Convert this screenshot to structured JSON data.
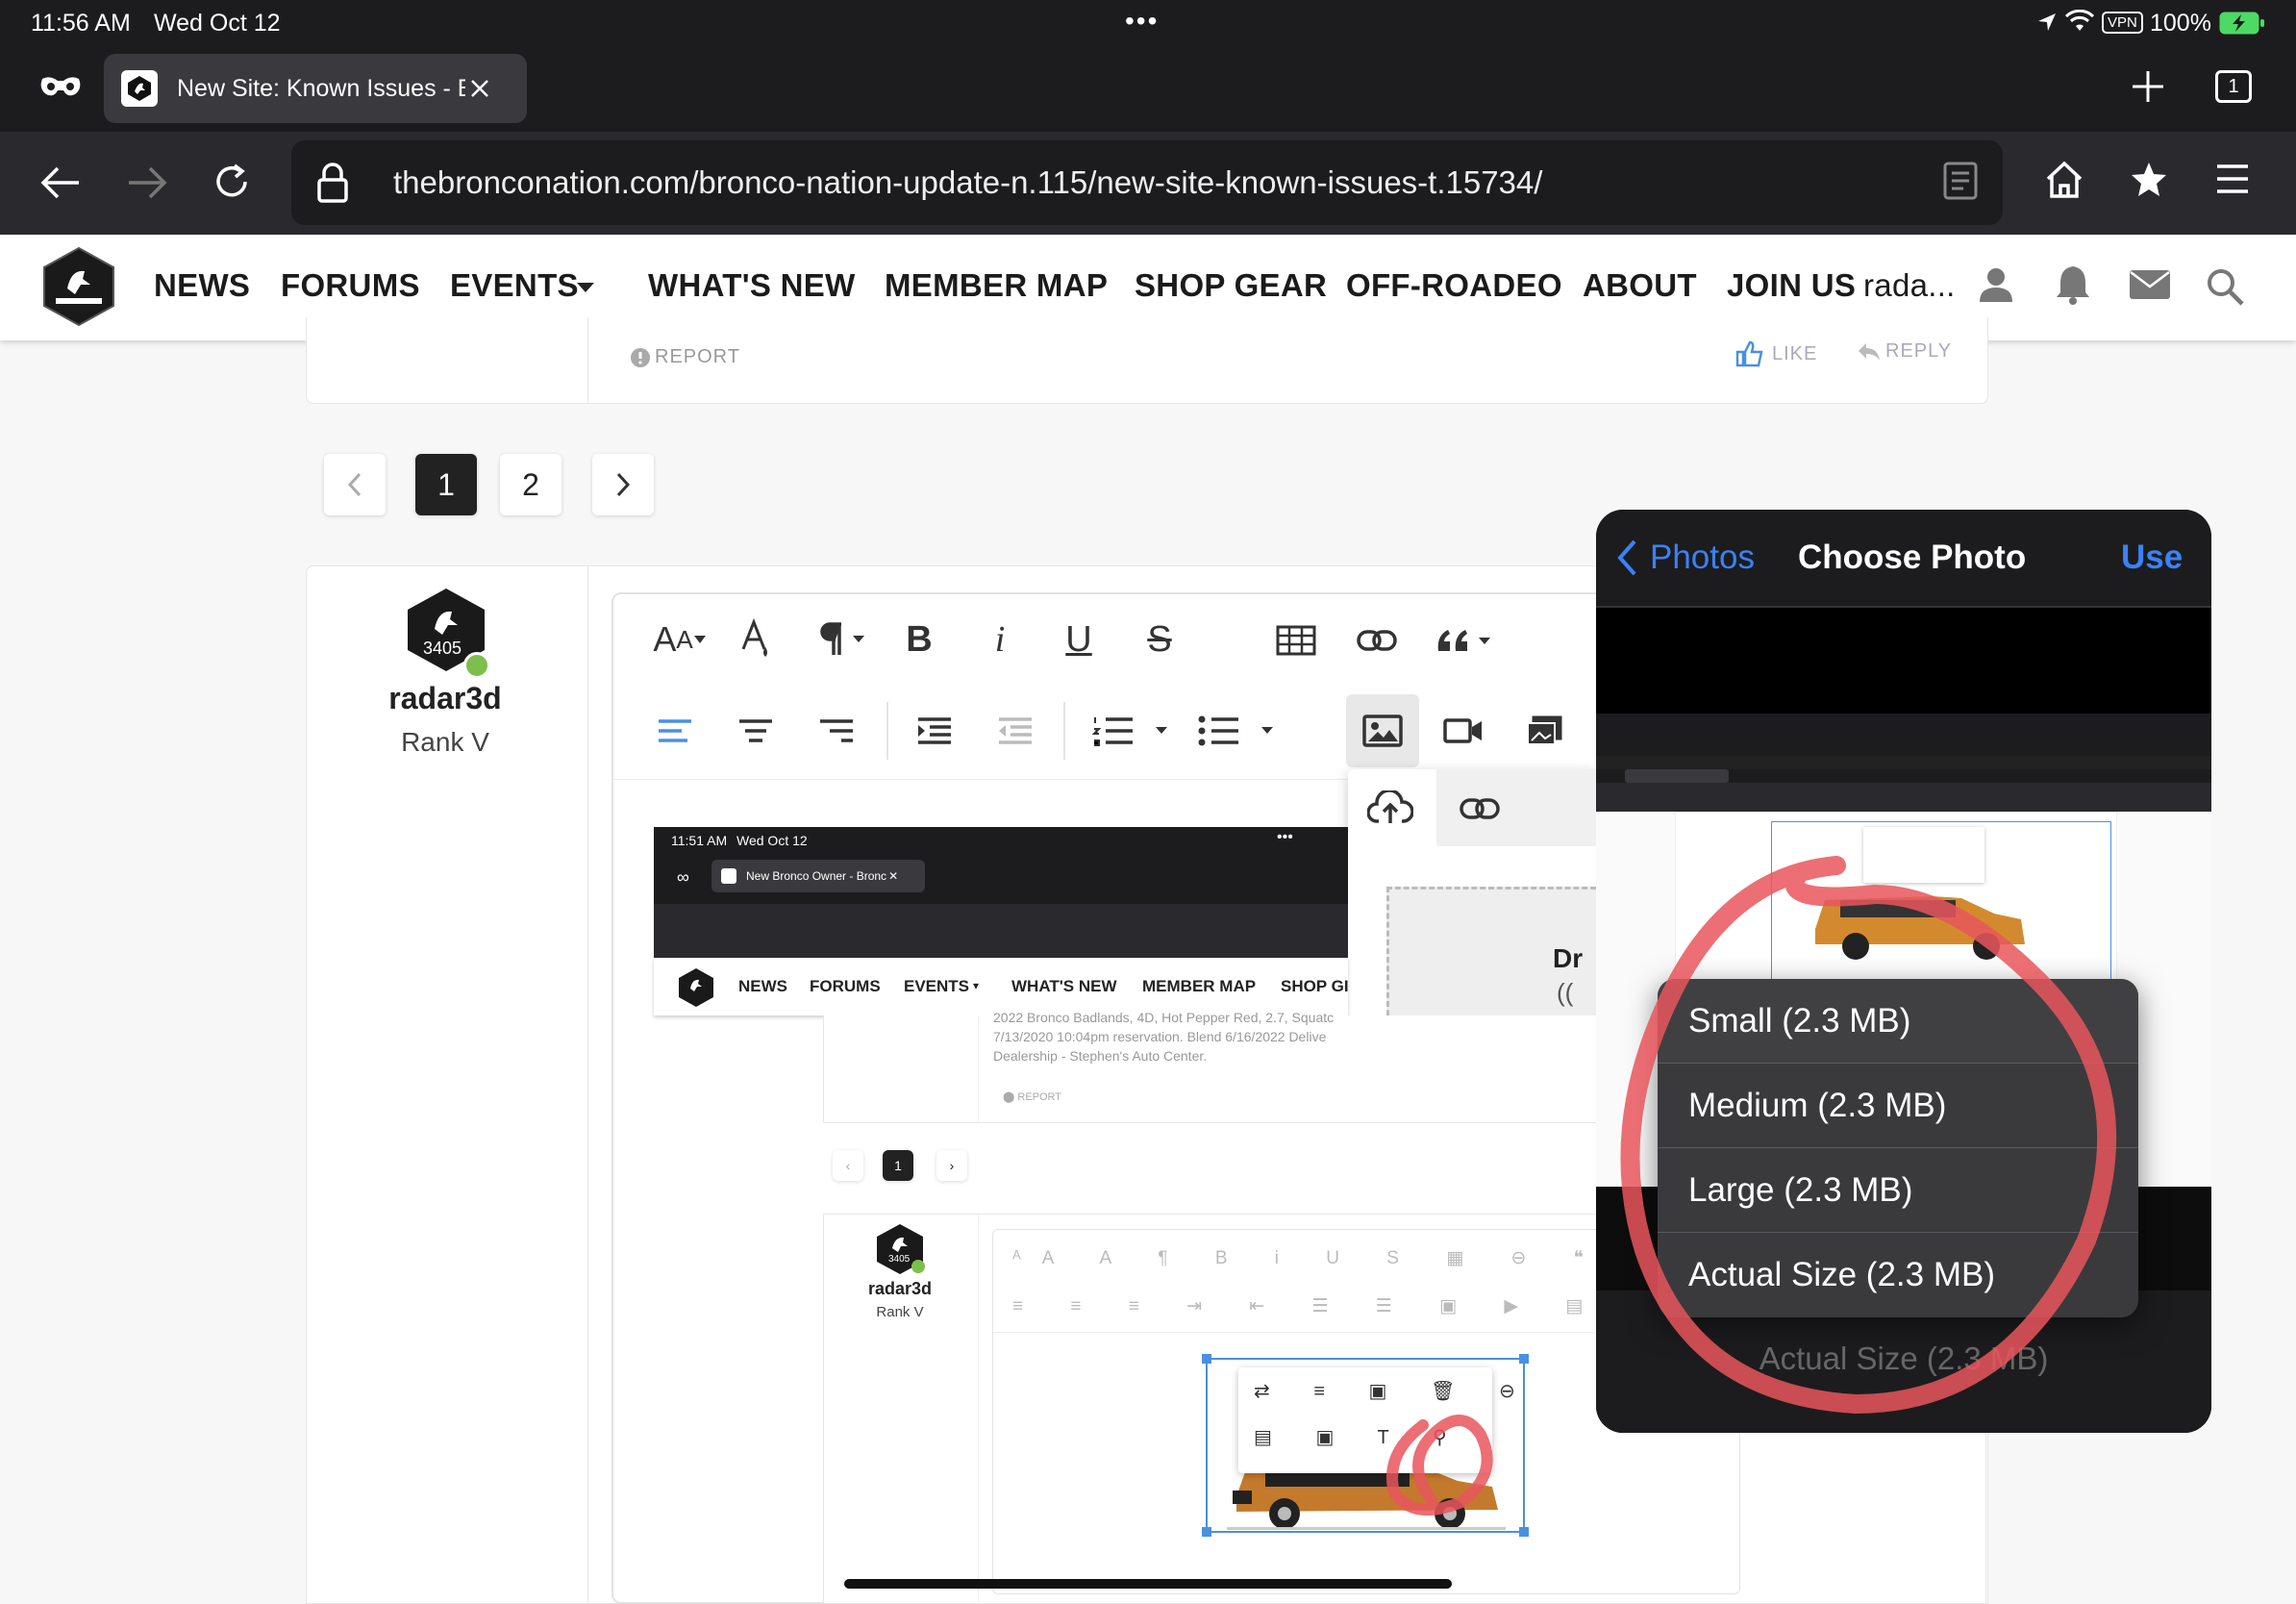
{
  "status": {
    "time": "11:56 AM",
    "date": "Wed Oct 12",
    "dots": "•••",
    "vpn": "VPN",
    "battery": "100%"
  },
  "browser": {
    "tab_title": "New Site: Known Issues - Bı",
    "tab_count": "1",
    "url": "thebronconation.com/bronco-nation-update-n.115/new-site-known-issues-t.15734/"
  },
  "site_nav": {
    "items": [
      "NEWS",
      "FORUMS",
      "EVENTS",
      "WHAT'S NEW",
      "MEMBER MAP",
      "SHOP GEAR",
      "OFF-ROADEO",
      "ABOUT",
      "JOIN US"
    ],
    "user": "rada..."
  },
  "post_actions": {
    "report": "REPORT",
    "like": "LIKE",
    "reply": "REPLY"
  },
  "pagination": {
    "pages": [
      "1",
      "2"
    ],
    "current": "1"
  },
  "author": {
    "name": "radar3d",
    "rank": "Rank V",
    "badge": "3405"
  },
  "editor": {
    "insert_popup_drop": "Dr",
    "insert_popup_sub": "(("
  },
  "embedded": {
    "status_time": "11:51 AM",
    "status_date": "Wed Oct 12",
    "tab_title": "New Bronco Owner - Bronc",
    "nav": [
      "NEWS",
      "FORUMS",
      "EVENTS",
      "WHAT'S NEW",
      "MEMBER MAP",
      "SHOP GI"
    ],
    "post_line1": "2022 Bronco Badlands, 4D, Hot Pepper Red, 2.7, Squatc",
    "post_line2": "7/13/2020 10:04pm reservation. Blend 6/16/2022 Delive",
    "post_line3": "Dealership - Stephen's Auto Center.",
    "report": "REPORT",
    "page": "1",
    "author": "radar3d",
    "rank": "Rank V",
    "badge": "3405"
  },
  "photo_picker": {
    "back_label": "Photos",
    "title": "Choose Photo",
    "use_label": "Use",
    "sizes": [
      "Small (2.3 MB)",
      "Medium (2.3 MB)",
      "Large (2.3 MB)",
      "Actual Size (2.3 MB)"
    ],
    "footer_size": "Actual Size (2.3 MB)"
  },
  "colors": {
    "accent": "#4a90e2",
    "ios_blue": "#3a82f7",
    "annotation": "#e8565c",
    "online": "#7cc04b"
  }
}
